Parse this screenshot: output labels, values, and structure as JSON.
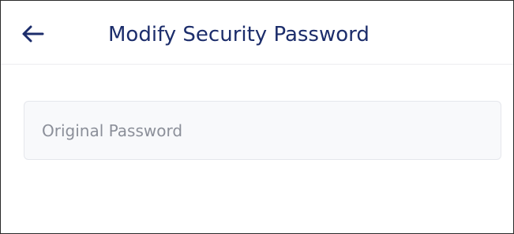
{
  "header": {
    "title": "Modify Security Password",
    "back_icon": "arrow-left-icon"
  },
  "form": {
    "original_password": {
      "placeholder": "Original Password",
      "value": ""
    }
  },
  "colors": {
    "title": "#1c2d6b",
    "back_icon": "#1c2d6b",
    "field_background": "#f8f9fb",
    "field_border": "#e5e7ec",
    "placeholder": "#8b8f99",
    "divider": "#ececf0"
  }
}
